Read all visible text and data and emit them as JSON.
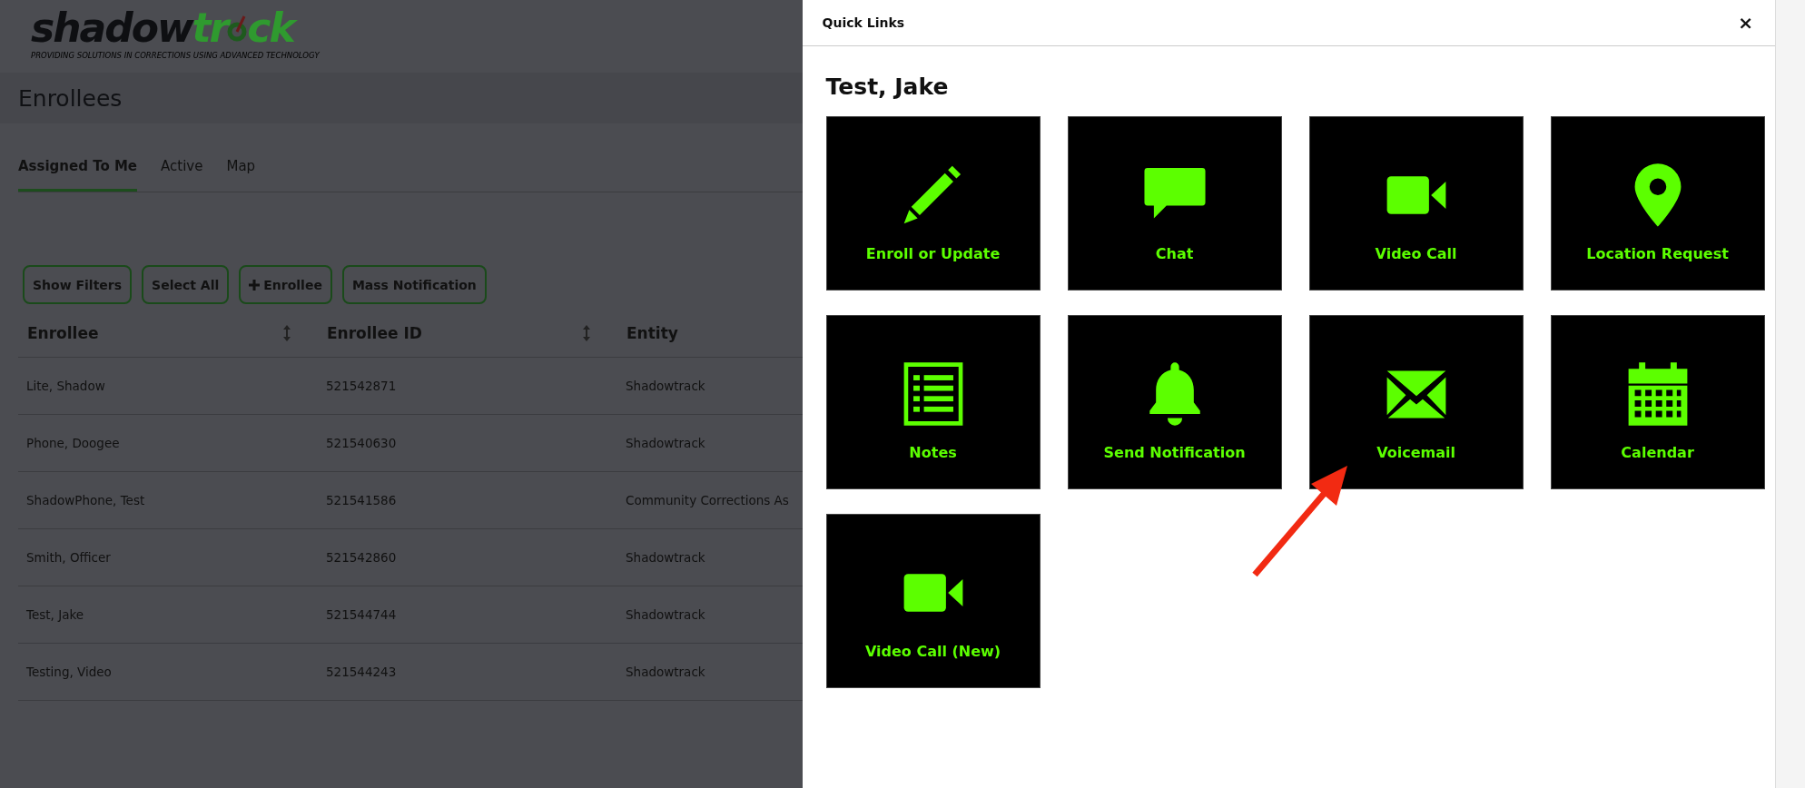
{
  "logo": {
    "word_1": "shadow",
    "word_2": "tr",
    "word_3": "ck",
    "tagline": "PROVIDING SOLUTIONS IN CORRECTIONS USING ADVANCED TECHNOLOGY"
  },
  "page_title": "Enrollees",
  "tabs": [
    {
      "label": "Assigned To Me",
      "selected": true
    },
    {
      "label": "Active",
      "selected": false
    },
    {
      "label": "Map",
      "selected": false
    }
  ],
  "buttons": [
    {
      "label": "Show Filters"
    },
    {
      "label": "Select All"
    },
    {
      "label": "Enrollee",
      "kind": "add"
    },
    {
      "label": "Mass Notification"
    }
  ],
  "table": {
    "columns": [
      {
        "label": "Enrollee",
        "sortable": true
      },
      {
        "label": "Enrollee ID",
        "sortable": true
      },
      {
        "label": "Entity",
        "sortable": false
      }
    ],
    "rows": [
      [
        "Lite, Shadow",
        "521542871",
        "Shadowtrack"
      ],
      [
        "Phone, Doogee",
        "521540630",
        "Shadowtrack"
      ],
      [
        "ShadowPhone, Test",
        "521541586",
        "Community Corrections As"
      ],
      [
        "Smith, Officer",
        "521542860",
        "Shadowtrack"
      ],
      [
        "Test, Jake",
        "521544744",
        "Shadowtrack"
      ],
      [
        "Testing, Video",
        "521544243",
        "Shadowtrack"
      ]
    ]
  },
  "panel": {
    "title": "Quick Links",
    "close": "×",
    "enrollee": "Test, Jake",
    "links": [
      {
        "label": "Enroll or Update",
        "kind": "pencil"
      },
      {
        "label": "Chat",
        "kind": "chat"
      },
      {
        "label": "Video Call",
        "kind": "video"
      },
      {
        "label": "Location Request",
        "kind": "pin"
      },
      {
        "label": "Notes",
        "kind": "notes"
      },
      {
        "label": "Send Notification",
        "kind": "bell"
      },
      {
        "label": "Voicemail",
        "kind": "mail"
      },
      {
        "label": "Calendar",
        "kind": "calendar"
      },
      {
        "label": "Video Call (New)",
        "kind": "video"
      }
    ]
  }
}
